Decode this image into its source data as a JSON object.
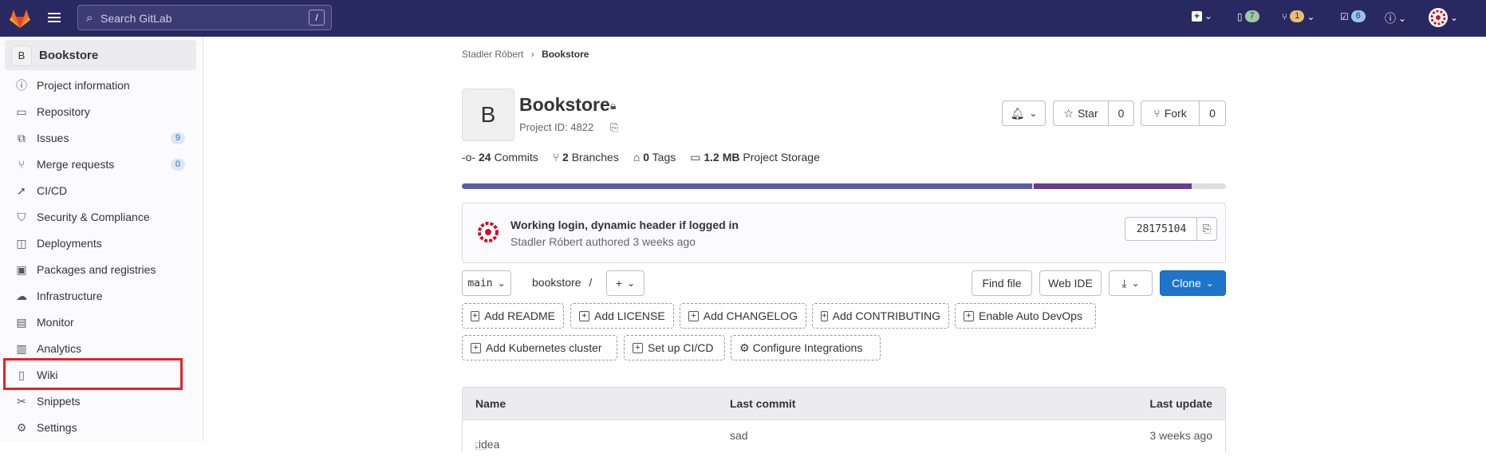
{
  "topbar": {
    "search_placeholder": "Search GitLab",
    "search_shortcut": "/",
    "mr_count": "7",
    "issues_count": "1",
    "todos_count": "6",
    "colors": {
      "bg": "#292961",
      "accent": "#fc6d26"
    }
  },
  "sidebar": {
    "project_initial": "B",
    "project_name": "Bookstore",
    "items": [
      {
        "label": "Project information",
        "icon": "info-icon"
      },
      {
        "label": "Repository",
        "icon": "doc-icon"
      },
      {
        "label": "Issues",
        "icon": "issues-icon",
        "count": "9"
      },
      {
        "label": "Merge requests",
        "icon": "merge-request-icon",
        "count": "0"
      },
      {
        "label": "CI/CD",
        "icon": "rocket-icon"
      },
      {
        "label": "Security & Compliance",
        "icon": "shield-icon"
      },
      {
        "label": "Deployments",
        "icon": "deployments-icon"
      },
      {
        "label": "Packages and registries",
        "icon": "package-icon"
      },
      {
        "label": "Infrastructure",
        "icon": "cloud-icon"
      },
      {
        "label": "Monitor",
        "icon": "monitor-icon"
      },
      {
        "label": "Analytics",
        "icon": "chart-icon"
      },
      {
        "label": "Wiki",
        "icon": "book-icon"
      },
      {
        "label": "Snippets",
        "icon": "scissors-icon"
      },
      {
        "label": "Settings",
        "icon": "gear-icon"
      }
    ]
  },
  "breadcrumb": {
    "parent": "Stadler Róbert",
    "current": "Bookstore"
  },
  "project": {
    "initial": "B",
    "title": "Bookstore",
    "id_text": "Project ID: 4822",
    "star_label": "Star",
    "star_count": "0",
    "fork_label": "Fork",
    "fork_count": "0"
  },
  "stats": {
    "commits_num": "24",
    "commits_label": "Commits",
    "branches_num": "2",
    "branches_label": "Branches",
    "tags_num": "0",
    "tags_label": "Tags",
    "storage_num": "1.2 MB",
    "storage_label": "Project Storage"
  },
  "commit": {
    "title": "Working login, dynamic header if logged in",
    "author": "Stadler Róbert",
    "meta": "authored 3 weeks ago",
    "sha": "28175104"
  },
  "repo_toolbar": {
    "branch": "main",
    "path": "bookstore",
    "sep": "/",
    "find_file": "Find file",
    "web_ide": "Web IDE",
    "clone": "Clone"
  },
  "quick_actions": [
    "Add README",
    "Add LICENSE",
    "Add CHANGELOG",
    "Add CONTRIBUTING",
    "Enable Auto DevOps",
    "Add Kubernetes cluster",
    "Set up CI/CD",
    "Configure Integrations"
  ],
  "table": {
    "headers": {
      "name": "Name",
      "last_commit": "Last commit",
      "last_update": "Last update"
    },
    "rows": [
      {
        "name": ".idea",
        "commit": "sad",
        "update": "3 weeks ago"
      }
    ]
  }
}
